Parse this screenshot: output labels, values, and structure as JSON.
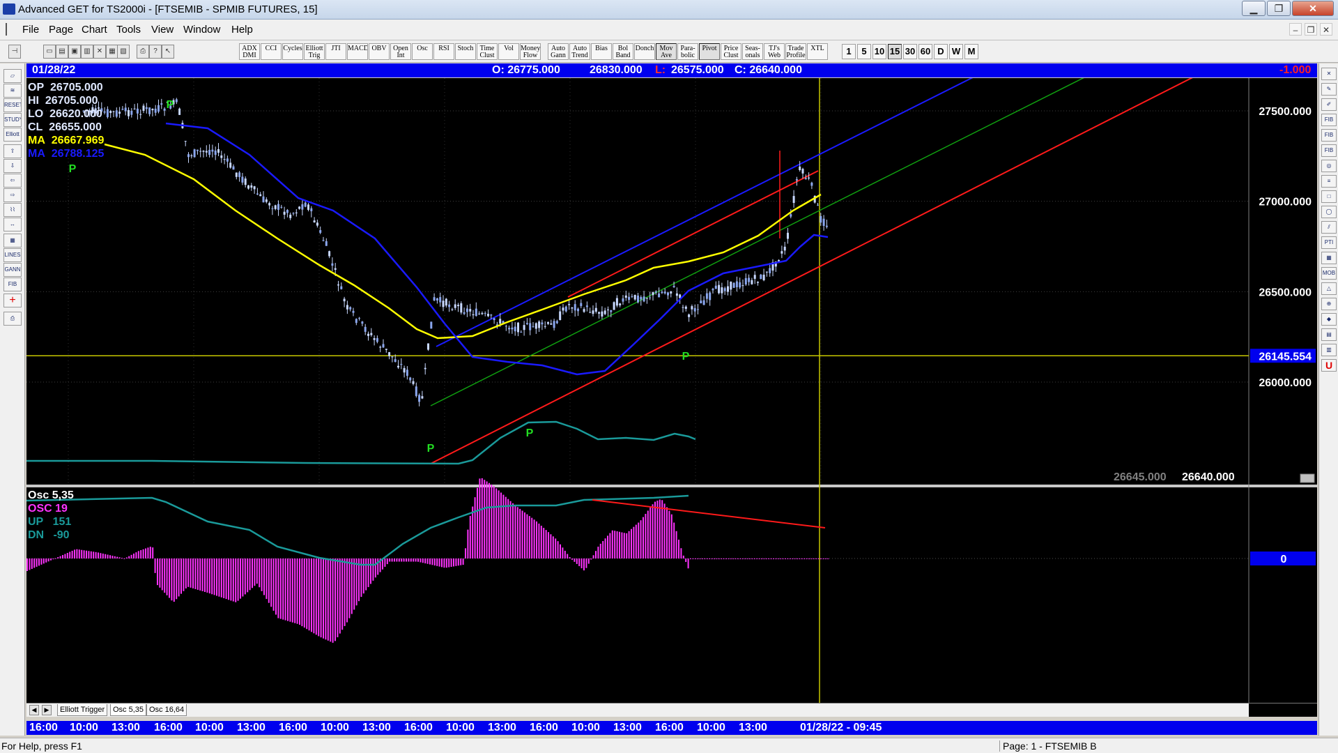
{
  "window": {
    "title": "Advanced GET for TS2000i - [FTSEMIB - SPMIB FUTURES, 15]",
    "controls": {
      "minimize": "▁",
      "maximize": "❐",
      "close": "✕"
    },
    "mdi_controls": {
      "minimize": "–",
      "restore": "❐",
      "close": "✕"
    }
  },
  "menu": [
    "File",
    "Page",
    "Chart",
    "Tools",
    "View",
    "Window",
    "Help"
  ],
  "toolbar": {
    "indicators": [
      "ADX DMI",
      "CCI",
      "Cycles",
      "Elliott Trig",
      "JTI",
      "MACD",
      "OBV",
      "Open Int",
      "Osc",
      "RSI",
      "Stoch",
      "Time Clust",
      "Vol",
      "Money Flow",
      "Auto Gann",
      "Auto Trend",
      "Bias",
      "Bol Band",
      "Donch",
      "Mov Ave",
      "Para-bolic",
      "Pivot",
      "Price Clust",
      "Seas-onals",
      "TJ's Web",
      "Trade Profile",
      "XTL"
    ],
    "active_indicators": [
      "Mov Ave",
      "Pivot"
    ],
    "intervals": [
      "1",
      "5",
      "10",
      "15",
      "30",
      "60",
      "D",
      "W",
      "M"
    ],
    "active_interval": "15"
  },
  "info_bar": {
    "date": "01/28/22",
    "open": "O: 26775.000",
    "high": "26830.000",
    "low_label": "L:",
    "low": "26575.000",
    "close": "C: 26640.000",
    "change": "-1.000"
  },
  "price_legend": {
    "op": {
      "label": "OP",
      "value": "26705.000"
    },
    "hi": {
      "label": "HI",
      "value": "26705.000"
    },
    "lo": {
      "label": "LO",
      "value": "26620.000"
    },
    "cl": {
      "label": "CL",
      "value": "26655.000"
    },
    "ma1": {
      "label": "MA",
      "value": "26667.969"
    },
    "ma2": {
      "label": "MA",
      "value": "26788.125"
    }
  },
  "osc_legend": {
    "title": "Osc 5,35",
    "osc": "OSC 19",
    "up": {
      "label": "UP",
      "value": "151"
    },
    "dn": {
      "label": "DN",
      "value": "-90"
    }
  },
  "price_axis": {
    "labels": [
      "27500.000",
      "27000.000",
      "26500.000",
      "26000.000"
    ],
    "cursor_value": "26145.554",
    "osc_zero": "0"
  },
  "readouts": {
    "left": "26645.000",
    "right": "26640.000"
  },
  "pivot_marker": "P",
  "tabs": [
    "Elliott Trigger",
    "Osc 5,35",
    "Osc 16,64"
  ],
  "active_tab": "Osc 5,35",
  "tab_nav": {
    "prev": "◀",
    "next": "▶"
  },
  "time_axis": {
    "labels": [
      "16:00",
      "10:00",
      "13:00",
      "16:00",
      "10:00",
      "13:00",
      "16:00",
      "10:00",
      "13:00",
      "16:00",
      "10:00",
      "13:00",
      "16:00",
      "10:00",
      "13:00",
      "16:00",
      "10:00",
      "13:00"
    ],
    "cursor": "01/28/22 - 09:45"
  },
  "status": {
    "help": "For Help, press F1",
    "page": "Page: 1 - FTSEMIB B"
  },
  "colors": {
    "accent_blue": "#0000ee",
    "ma_fast": "#ffff00",
    "ma_slow": "#1a1aff",
    "osc": "#ff33ff",
    "bands": "#1a9a9a",
    "channel_red": "#ff1a1a",
    "pivot_green": "#22dd22"
  }
}
